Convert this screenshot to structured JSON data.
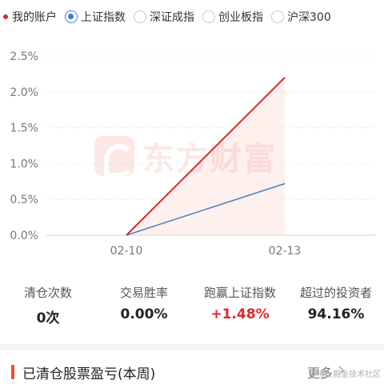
{
  "legend": {
    "my_account": "我的账户",
    "indices": [
      {
        "label": "上证指数",
        "checked": true
      },
      {
        "label": "深证成指",
        "checked": false
      },
      {
        "label": "创业板指",
        "checked": false
      },
      {
        "label": "沪深300",
        "checked": false
      }
    ]
  },
  "watermark": {
    "text": "东方财富"
  },
  "colors": {
    "my_account": "#d0302f",
    "index": "#4a7fc4",
    "positive": "#e0262d",
    "accent": "#e8522c"
  },
  "chart_data": {
    "type": "line",
    "x": [
      "02-10",
      "02-13"
    ],
    "series": [
      {
        "name": "我的账户",
        "values": [
          0.0,
          2.2
        ]
      },
      {
        "name": "上证指数",
        "values": [
          0.0,
          0.72
        ]
      }
    ],
    "ytick_labels": [
      "0.0%",
      "0.5%",
      "1.0%",
      "1.5%",
      "2.0%",
      "2.5%"
    ],
    "yticks": [
      0,
      0.5,
      1.0,
      1.5,
      2.0,
      2.5
    ],
    "ylim": [
      0,
      2.5
    ],
    "grid": true,
    "legend": "top-left"
  },
  "stats": [
    {
      "label": "清仓次数",
      "value": "0次"
    },
    {
      "label": "交易胜率",
      "value": "0.00%"
    },
    {
      "label": "跑赢上证指数",
      "value": "+1.48%"
    },
    {
      "label": "超过的投资者",
      "value": "94.16%"
    }
  ],
  "section": {
    "title": "已清仓股票盈亏(本周)",
    "more": "更多"
  },
  "credit": "@稀土掘金技术社区"
}
